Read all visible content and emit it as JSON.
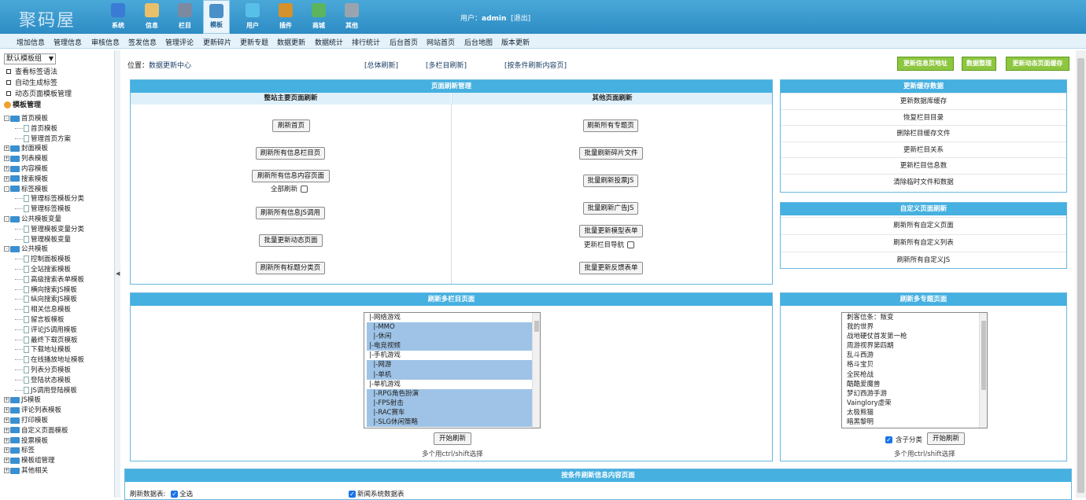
{
  "app": {
    "logo": "聚码屋"
  },
  "top_nav": [
    {
      "label": "系统",
      "icon": "globe-icon",
      "color": "#3a7bd5"
    },
    {
      "label": "信息",
      "icon": "document-edit-icon",
      "color": "#e8c06a"
    },
    {
      "label": "栏目",
      "icon": "folder-icon",
      "color": "#7b8aa0"
    },
    {
      "label": "模板",
      "icon": "template-window-icon",
      "color": "#4a90c8"
    },
    {
      "label": "用户",
      "icon": "user-icon",
      "color": "#58c0e8"
    },
    {
      "label": "插件",
      "icon": "tools-icon",
      "color": "#d4912c"
    },
    {
      "label": "商城",
      "icon": "shop-icon",
      "color": "#5ab55e"
    },
    {
      "label": "其他",
      "icon": "gear-icon",
      "color": "#9aa4ae"
    }
  ],
  "user": {
    "prefix": "用户：",
    "name": "admin",
    "logout": "[退出]"
  },
  "menu": [
    "增加信息",
    "管理信息",
    "审核信息",
    "签发信息",
    "管理评论",
    "更新碎片",
    "更新专题",
    "数据更新",
    "数据统计",
    "排行统计",
    "后台首页",
    "网站首页",
    "后台地图",
    "版本更新"
  ],
  "sidebar": {
    "group_select": "默认模板组",
    "tools": [
      "查看标签语法",
      "自动生成标签",
      "动态页面模板管理"
    ],
    "tree_title": "模板管理",
    "tree": [
      {
        "label": "首页模板",
        "type": "folder",
        "level": 0,
        "pm": "-"
      },
      {
        "label": "首页模板",
        "type": "doc",
        "level": 1
      },
      {
        "label": "管理首页方案",
        "type": "doc",
        "level": 1
      },
      {
        "label": "封面模板",
        "type": "folder",
        "level": 0,
        "pm": "+"
      },
      {
        "label": "列表模板",
        "type": "folder",
        "level": 0,
        "pm": "+"
      },
      {
        "label": "内容模板",
        "type": "folder",
        "level": 0,
        "pm": "+"
      },
      {
        "label": "搜索模板",
        "type": "folder",
        "level": 0,
        "pm": "+"
      },
      {
        "label": "标签模板",
        "type": "folder",
        "level": 0,
        "pm": "-"
      },
      {
        "label": "管理标签模板分类",
        "type": "doc",
        "level": 1
      },
      {
        "label": "管理标签模板",
        "type": "doc",
        "level": 1
      },
      {
        "label": "公共模板变量",
        "type": "folder",
        "level": 0,
        "pm": "-"
      },
      {
        "label": "管理模板变量分类",
        "type": "doc",
        "level": 1
      },
      {
        "label": "管理模板变量",
        "type": "doc",
        "level": 1
      },
      {
        "label": "公共模板",
        "type": "folder",
        "level": 0,
        "pm": "-"
      },
      {
        "label": "控制面板模板",
        "type": "doc",
        "level": 1
      },
      {
        "label": "全站搜索模板",
        "type": "doc",
        "level": 1
      },
      {
        "label": "高级搜索表单模板",
        "type": "doc",
        "level": 1
      },
      {
        "label": "横向搜索JS模板",
        "type": "doc",
        "level": 1
      },
      {
        "label": "纵向搜索JS模板",
        "type": "doc",
        "level": 1
      },
      {
        "label": "相关信息模板",
        "type": "doc",
        "level": 1
      },
      {
        "label": "留言板模板",
        "type": "doc",
        "level": 1
      },
      {
        "label": "评论JS调用模板",
        "type": "doc",
        "level": 1
      },
      {
        "label": "最终下载页模板",
        "type": "doc",
        "level": 1
      },
      {
        "label": "下载地址模板",
        "type": "doc",
        "level": 1
      },
      {
        "label": "在线播放地址模板",
        "type": "doc",
        "level": 1
      },
      {
        "label": "列表分页模板",
        "type": "doc",
        "level": 1
      },
      {
        "label": "登陆状态模板",
        "type": "doc",
        "level": 1
      },
      {
        "label": "JS调用登陆模板",
        "type": "doc",
        "level": 1
      },
      {
        "label": "JS模板",
        "type": "folder",
        "level": 0,
        "pm": "+"
      },
      {
        "label": "评论列表模板",
        "type": "folder",
        "level": 0,
        "pm": "+"
      },
      {
        "label": "打印模板",
        "type": "folder",
        "level": 0,
        "pm": "+"
      },
      {
        "label": "自定义页面模板",
        "type": "folder",
        "level": 0,
        "pm": "+"
      },
      {
        "label": "投票模板",
        "type": "folder",
        "level": 0,
        "pm": "+"
      },
      {
        "label": "标签",
        "type": "folder",
        "level": 0,
        "pm": "+"
      },
      {
        "label": "模板组管理",
        "type": "folder",
        "level": 0,
        "pm": "+"
      },
      {
        "label": "其他相关",
        "type": "folder",
        "level": 0,
        "pm": "+"
      }
    ]
  },
  "location": {
    "label": "位置：",
    "page": "数据更新中心"
  },
  "top_links": [
    "[总体刷新]",
    "[多栏目刷新]",
    "[按条件刷新内容页]"
  ],
  "top_buttons": [
    "更新信息页地址",
    "数据整理",
    "更新动态页面缓存"
  ],
  "page_refresh": {
    "title": "页面刷新管理",
    "left_title": "整站主要页面刷新",
    "right_title": "其他页面刷新",
    "left_buttons": [
      "刷新首页",
      "刷新所有信息栏目页",
      "刷新所有信息内容页面",
      "刷新所有信息JS调用",
      "批量更新动态页面",
      "刷新所有标题分类页"
    ],
    "left_check": "全部刷新",
    "right_buttons": [
      "刷新所有专题页",
      "批量刷新碎片文件",
      "批量刷新投票JS",
      "批量刷新广告JS",
      "批量更新模型表单",
      "批量更新反馈表单"
    ],
    "right_check": "更新栏目导航"
  },
  "cache": {
    "title": "更新缓存数据",
    "items": [
      "更新数据库缓存",
      "恢复栏目目录",
      "删除栏目缓存文件",
      "更新栏目关系",
      "更新栏目信息数",
      "清除临时文件和数据"
    ]
  },
  "custom": {
    "title": "自定义页面刷新",
    "items": [
      "刷新所有自定义页面",
      "刷新所有自定义列表",
      "刷新所有自定义JS"
    ]
  },
  "multi_column": {
    "title": "刷新多栏目页面",
    "options": [
      {
        "label": "|-网络游戏",
        "selected": false
      },
      {
        "label": "  |-MMO",
        "selected": true
      },
      {
        "label": "  |-休闲",
        "selected": true
      },
      {
        "label": "|-电竞视频",
        "selected": true
      },
      {
        "label": "|-手机游戏",
        "selected": false
      },
      {
        "label": "  |-网游",
        "selected": true
      },
      {
        "label": "  |-单机",
        "selected": true
      },
      {
        "label": "|-单机游戏",
        "selected": false
      },
      {
        "label": "  |-RPG角色扮演",
        "selected": true
      },
      {
        "label": "  |-FPS射击",
        "selected": true
      },
      {
        "label": "  |-RAC赛车",
        "selected": true
      },
      {
        "label": "  |-SLG休闲策略",
        "selected": true
      }
    ],
    "button": "开始刷新",
    "hint": "多个用ctrl/shift选择"
  },
  "multi_topic": {
    "title": "刷新多专题页面",
    "options": [
      "刺客信条：叛变",
      "我的世界",
      "战地硬仗首发第一枪",
      "周游视界第四期",
      "乱斗西游",
      "格斗宝贝",
      "全民枪战",
      "酷酷爱魔兽",
      "梦幻西游手游",
      "Vainglory虚荣",
      "太极熊猫",
      "暗黑黎明"
    ],
    "check": "含子分类",
    "button": "开始刷新",
    "hint": "多个用ctrl/shift选择"
  },
  "condition": {
    "title": "按条件刷新信息内容页面",
    "table_label": "刷新数据表:",
    "all_label": "全选",
    "table_item": "新闻系统数据表"
  }
}
